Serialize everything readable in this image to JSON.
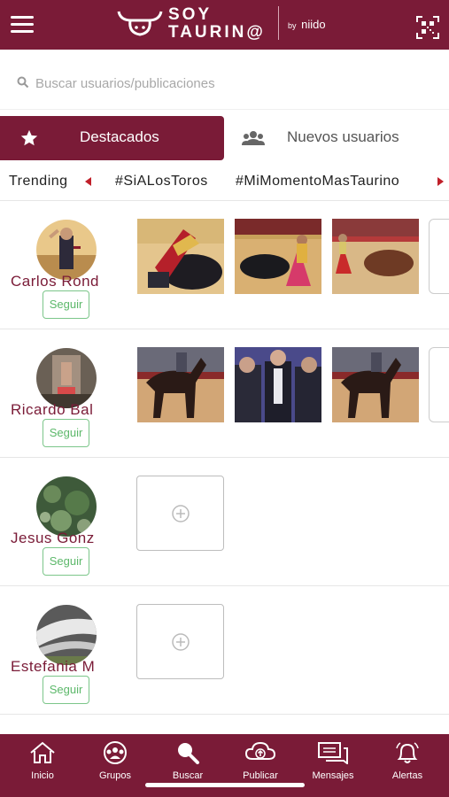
{
  "header": {
    "logo_line1": "SOY",
    "logo_line2": "TAURIN@",
    "logo_by": "by",
    "logo_brand": "niido"
  },
  "search": {
    "placeholder": "Buscar usuarios/publicaciones"
  },
  "tabs": [
    {
      "label": "Destacados",
      "icon": "star-icon",
      "active": true
    },
    {
      "label": "Nuevos usuarios",
      "icon": "people-icon",
      "active": false
    }
  ],
  "trending": {
    "label": "Trending",
    "tags": [
      "#SiALosToros",
      "#MiMomentoMasTaurino"
    ]
  },
  "users": [
    {
      "name": "Carlos Rond",
      "follow_label": "Seguir",
      "has_posts": true
    },
    {
      "name": "Ricardo Bal",
      "follow_label": "Seguir",
      "has_posts": true
    },
    {
      "name": "Jesus Gonz",
      "follow_label": "Seguir",
      "has_posts": false
    },
    {
      "name": "Estefania M",
      "follow_label": "Seguir",
      "has_posts": false
    }
  ],
  "bottom_nav": [
    {
      "label": "Inicio",
      "icon": "home-icon"
    },
    {
      "label": "Grupos",
      "icon": "groups-icon"
    },
    {
      "label": "Buscar",
      "icon": "search-icon"
    },
    {
      "label": "Publicar",
      "icon": "upload-cloud-icon"
    },
    {
      "label": "Mensajes",
      "icon": "messages-icon"
    },
    {
      "label": "Alertas",
      "icon": "bell-icon"
    }
  ],
  "colors": {
    "brand": "#7a1b37",
    "follow_green": "#5cb86a",
    "trending_arrow": "#c0202a"
  }
}
